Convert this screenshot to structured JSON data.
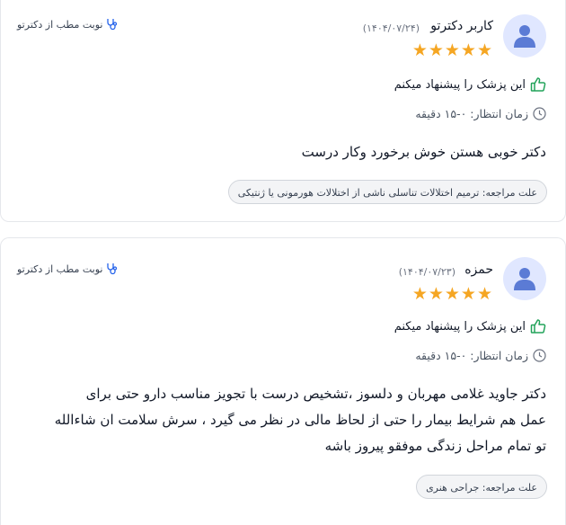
{
  "reviews": [
    {
      "author": "کاربر دکترتو",
      "date": "(۱۴۰۴/۰۷/۲۴)",
      "rating": 5,
      "stars": "★★★★★",
      "recommend": "این پزشک را پیشنهاد میکنم",
      "wait_time": "زمان انتظار: ۰-۱۵ دقیقه",
      "comment": "دکتر خوبی هستن خوش برخورد وکار درست",
      "reason_label": "علت مراجعه:",
      "reason": "ترمیم اختلالات تناسلی ناشی از اختلالات هورمونی یا ژنتیکی",
      "booking": "نوبت مطب از دکترتو"
    },
    {
      "author": "حمزه",
      "date": "(۱۴۰۴/۰۷/۲۳)",
      "rating": 5,
      "stars": "★★★★★",
      "recommend": "این پزشک را پیشنهاد میکنم",
      "wait_time": "زمان انتظار: ۰-۱۵ دقیقه",
      "comment_lines": [
        "دکتر جاوید غلامی مهربان و دلسوز ،تشخیص درست با تجویز مناسب دارو حتی برای",
        "عمل هم شرایط بیمار را حتی از لحاظ مالی در نظر می گیرد ، سرش سلامت ان شاءالله",
        "تو تمام مراحل زندگی موفقو پیروز باشه"
      ],
      "reason_label": "علت مراجعه:",
      "reason": "جراحی هنری",
      "booking": "نوبت مطب از دکترتو"
    }
  ],
  "colors": {
    "star": "#f5a623",
    "thumb": "#22a35a",
    "icon_accent": "#2563eb",
    "avatar_bg": "#e0e7ff",
    "avatar_fg": "#5b7bd5"
  },
  "icons": {
    "avatar": "user-icon",
    "recommend": "thumbs-up-icon",
    "wait": "clock-icon",
    "booking": "stethoscope-icon"
  }
}
